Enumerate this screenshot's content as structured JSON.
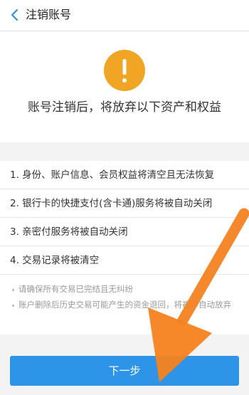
{
  "header": {
    "title": "注销账号",
    "back_icon": "chevron-left-icon"
  },
  "hero": {
    "icon": "exclamation-icon",
    "icon_color": "#f0a624",
    "message": "账号注销后，将放弃以下资产和权益"
  },
  "items": [
    {
      "label": "1. 身份、账户信息、会员权益将清空且无法恢复"
    },
    {
      "label": "2. 银行卡的快捷支付(含卡通)服务将被自动关闭"
    },
    {
      "label": "3. 亲密付服务将被自动关闭"
    },
    {
      "label": "4. 交易记录将被清空"
    }
  ],
  "notes": [
    "请确保所有交易已完结且无纠纷",
    "账户删除后历史交易可能产生的资金退回，将视作自动放弃"
  ],
  "next_button": {
    "label": "下一步",
    "color": "#2e94e8"
  },
  "overlay": {
    "arrow_icon": "orange-arrow-icon",
    "arrow_color": "#f5821f"
  }
}
